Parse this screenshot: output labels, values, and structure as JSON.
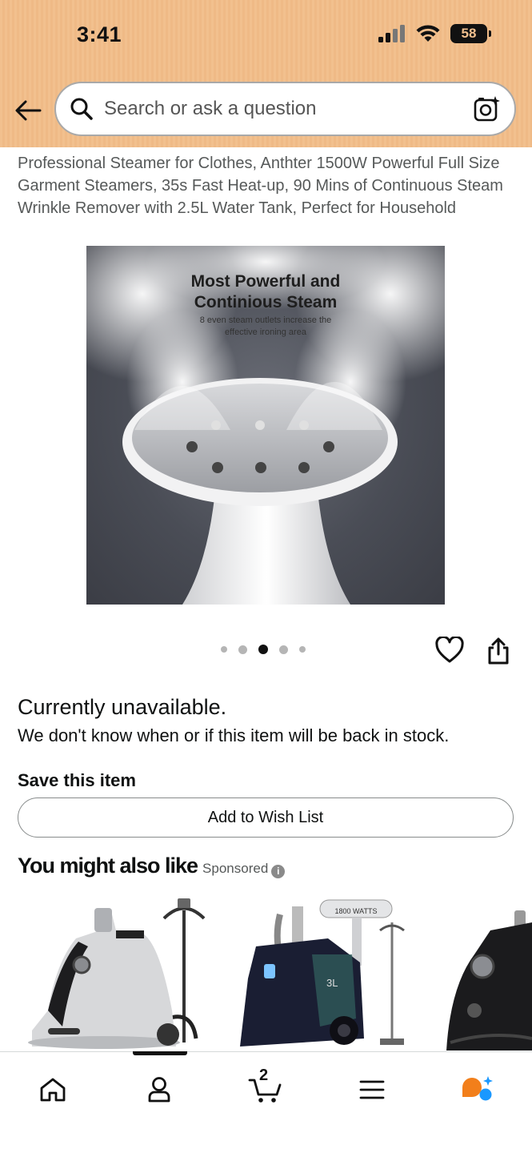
{
  "status_bar": {
    "time": "3:41",
    "battery": "58"
  },
  "search": {
    "placeholder": "Search or ask a question"
  },
  "product": {
    "title": "Professional Steamer for Clothes, Anthter 1500W Powerful Full Size Garment Steamers, 35s Fast Heat-up, 90 Mins of Continuous Steam Wrinkle Remover with 2.5L Water Tank, Perfect for Household",
    "image": {
      "headline_line1": "Most Powerful and",
      "headline_line2": "Continious Steam",
      "sub_line1": "8 even steam outlets increase the",
      "sub_line2": "effective ironing area"
    },
    "carousel": {
      "count": 5,
      "active_index": 2
    }
  },
  "availability": {
    "status": "Currently unavailable.",
    "message": "We don't know when or if this item will be back in stock."
  },
  "save_section": {
    "title": "Save this item",
    "wishlist_button": "Add to Wish List"
  },
  "recommendations": {
    "title": "You might also like",
    "sponsored_label": "Sponsored",
    "items": [
      {
        "brand_text": ""
      },
      {
        "brand_text": "1800 WATTS",
        "tank_label": "3L"
      },
      {
        "brand_text": ""
      }
    ]
  },
  "bottom_nav": {
    "items": [
      {
        "name": "home-icon"
      },
      {
        "name": "account-icon"
      },
      {
        "name": "cart-icon",
        "badge": "2"
      },
      {
        "name": "menu-icon"
      },
      {
        "name": "rufus-ai-icon"
      }
    ],
    "active_index": 1,
    "accent_colors": {
      "orange": "#f27f1b",
      "blue": "#1a98ff"
    }
  }
}
